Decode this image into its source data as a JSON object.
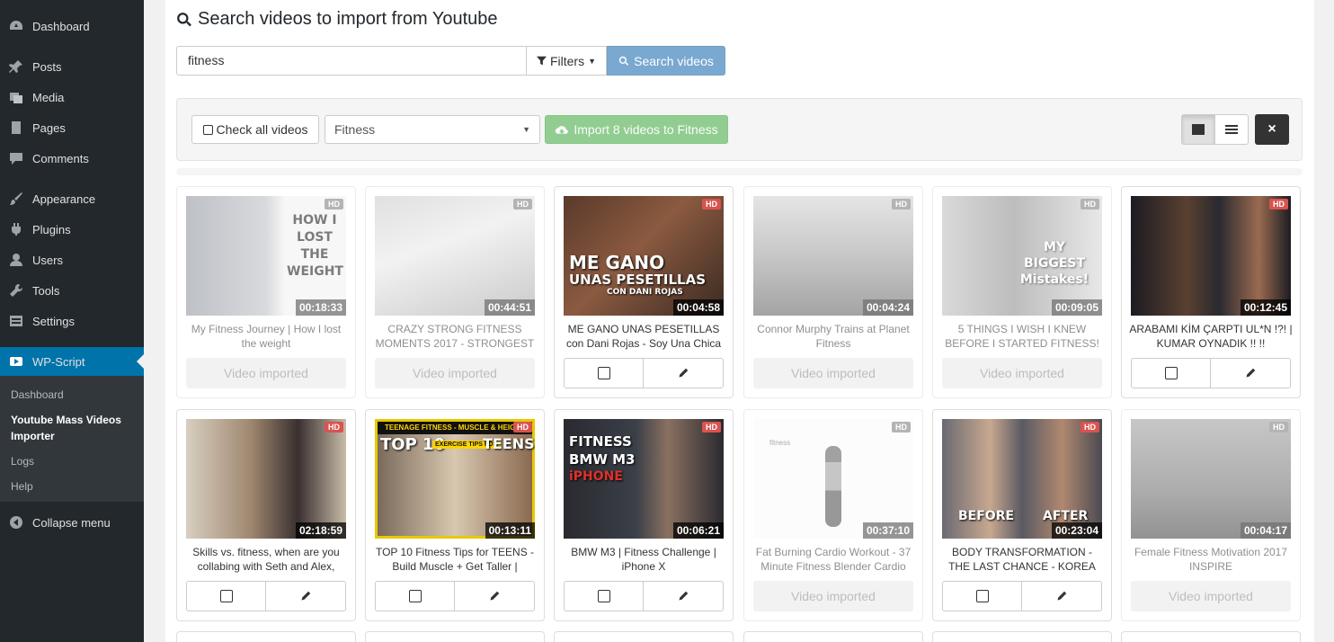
{
  "sidebar": {
    "items": [
      {
        "label": "Dashboard",
        "icon": "dashboard-icon"
      },
      {
        "label": "Posts",
        "icon": "pin-icon"
      },
      {
        "label": "Media",
        "icon": "media-icon"
      },
      {
        "label": "Pages",
        "icon": "pages-icon"
      },
      {
        "label": "Comments",
        "icon": "comments-icon"
      },
      {
        "label": "Appearance",
        "icon": "brush-icon"
      },
      {
        "label": "Plugins",
        "icon": "plug-icon"
      },
      {
        "label": "Users",
        "icon": "user-icon"
      },
      {
        "label": "Tools",
        "icon": "wrench-icon"
      },
      {
        "label": "Settings",
        "icon": "settings-icon"
      },
      {
        "label": "WP-Script",
        "icon": "video-icon"
      }
    ],
    "submenu": [
      "Dashboard",
      "Youtube Mass Videos Importer",
      "Logs",
      "Help"
    ],
    "collapse": "Collapse menu"
  },
  "search": {
    "title": "Search videos to import from Youtube",
    "query": "fitness",
    "filters_label": "Filters",
    "button_label": "Search videos"
  },
  "toolbar": {
    "check_all_label": "Check all videos",
    "category": "Fitness",
    "import_label": "Import 8 videos to Fitness",
    "close_label": "×"
  },
  "status": {
    "imported_label": "Video imported",
    "hd_label": "HD"
  },
  "videos": [
    {
      "title": "My Fitness Journey | How I lost the weight",
      "duration": "00:18:33",
      "imported": true
    },
    {
      "title": "CRAZY STRONG FITNESS MOMENTS 2017 - STRONGEST",
      "duration": "00:44:51",
      "imported": true
    },
    {
      "title": "ME GANO UNAS PESETILLAS con Dani Rojas - Soy Una Chica",
      "duration": "00:04:58",
      "imported": false
    },
    {
      "title": "Connor Murphy Trains at Planet Fitness",
      "duration": "00:04:24",
      "imported": true
    },
    {
      "title": "5 THINGS I WISH I KNEW BEFORE I STARTED FITNESS!",
      "duration": "00:09:05",
      "imported": true
    },
    {
      "title": "ARABAMI KİM ÇARPTI UL*N !?! | KUMAR OYNADIK !! !!",
      "duration": "00:12:45",
      "imported": false
    },
    {
      "title": "Skills vs. fitness, when are you collabing with Seth and Alex,",
      "duration": "02:18:59",
      "imported": false
    },
    {
      "title": "TOP 10 Fitness Tips for TEENS - Build Muscle + Get Taller |",
      "duration": "00:13:11",
      "imported": false
    },
    {
      "title": "BMW M3 | Fitness Challenge | iPhone X",
      "duration": "00:06:21",
      "imported": false
    },
    {
      "title": "Fat Burning Cardio Workout - 37 Minute Fitness Blender Cardio",
      "duration": "00:37:10",
      "imported": true
    },
    {
      "title": "BODY TRANSFORMATION - THE LAST CHANCE - KOREA",
      "duration": "00:23:04",
      "imported": false
    },
    {
      "title": "Female Fitness Motivation 2017 INSPIRE",
      "duration": "00:04:17",
      "imported": true
    }
  ],
  "thumb_captions": {
    "t0": "HOW I LOST THE WEIGHT",
    "t2a": "ME GANO",
    "t2b": "UNAS PESETILLAS",
    "t2c": "CON DANI ROJAS",
    "t4": "MY BIGGEST Mistakes!",
    "t7a": "TEENAGE FITNESS - MUSCLE & HEIGHT",
    "t7b": "TOP 10",
    "t7c": "EXERCISE TIPS FOR",
    "t7d": "TEENS",
    "t8a": "FITNESS",
    "t8b": "BMW M3",
    "t8c": "iPHONE",
    "t9": "fitness",
    "t10a": "BEFORE",
    "t10b": "AFTER"
  }
}
